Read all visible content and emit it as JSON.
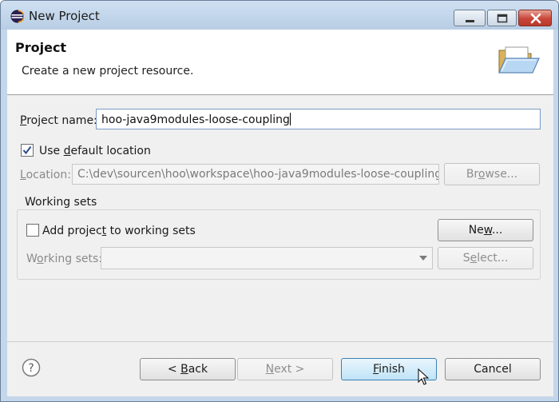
{
  "window": {
    "title": "New Project"
  },
  "header": {
    "title": "Project",
    "description": "Create a new project resource."
  },
  "form": {
    "project_name": {
      "label_pre": "",
      "label_mnemonic": "P",
      "label_post": "roject name:",
      "value": "hoo-java9modules-loose-coupling"
    },
    "default_location": {
      "checked": true,
      "label_pre": "Use ",
      "label_mnemonic": "d",
      "label_post": "efault location"
    },
    "location": {
      "label_pre": "",
      "label_mnemonic": "L",
      "label_post": "ocation:",
      "value": "C:\\dev\\sourcen\\hoo\\workspace\\hoo-java9modules-loose-coupling",
      "browse_pre": "Br",
      "browse_mnemonic": "o",
      "browse_post": "wse..."
    }
  },
  "working_sets": {
    "group_title": "Working sets",
    "add_checkbox": {
      "checked": false,
      "label_pre": "Add projec",
      "label_mnemonic": "t",
      "label_post": " to working sets"
    },
    "new_button": {
      "pre": "Ne",
      "mnemonic": "w",
      "post": "..."
    },
    "sets_label": {
      "pre": "W",
      "mnemonic": "o",
      "post": "rking sets:"
    },
    "selected": "",
    "select_button": {
      "pre": "S",
      "mnemonic": "e",
      "post": "lect..."
    }
  },
  "footer": {
    "back": {
      "pre": "< ",
      "mnemonic": "B",
      "post": "ack"
    },
    "next": {
      "pre": "",
      "mnemonic": "N",
      "post": "ext >"
    },
    "finish": {
      "pre": "",
      "mnemonic": "F",
      "post": "inish"
    },
    "cancel": "Cancel"
  },
  "colors": {
    "titlebar": "#c4d6ea",
    "primary_button": "#bfe3f7",
    "close_button": "#c8453a"
  }
}
